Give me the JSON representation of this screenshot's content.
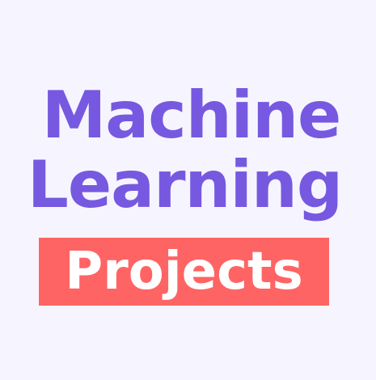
{
  "title": {
    "line1": "Machine",
    "line2": "Learning"
  },
  "badge": {
    "label": "Projects"
  },
  "colors": {
    "background": "#f6f5ff",
    "title": "#7659e0",
    "badge_background": "#ff6464",
    "badge_text": "#ffffff"
  }
}
